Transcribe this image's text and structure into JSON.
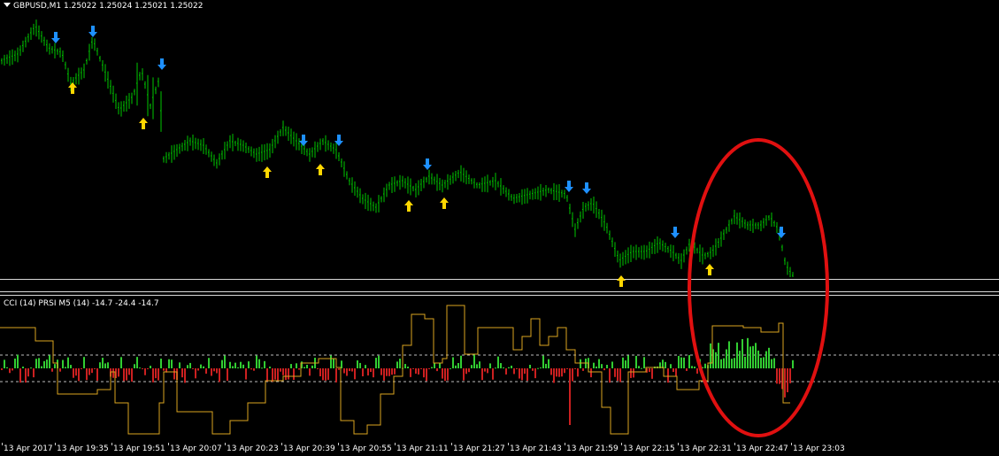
{
  "window": {
    "main_title": "GBPUSD,M1  1.25022 1.25024 1.25021 1.25022",
    "sub_title": "CCI (14) PRSI M5 (14) -14.7 -24.4 -14.7"
  },
  "colors": {
    "background": "#000000",
    "candle": "#00c800",
    "up_arrow": "#ffd700",
    "down_arrow": "#1e90ff",
    "hist_pos": "#32cd32",
    "hist_neg": "#cc2020",
    "prsi_line": "#daa520",
    "highlight": "#e01010"
  },
  "icons": {
    "up_arrow": "arrow-up-icon",
    "down_arrow": "arrow-down-icon",
    "menu": "triangle-down-icon"
  },
  "time_axis": [
    "13 Apr 2017",
    "13 Apr 19:35",
    "13 Apr 19:51",
    "13 Apr 20:07",
    "13 Apr 20:23",
    "13 Apr 20:39",
    "13 Apr 20:55",
    "13 Apr 21:11",
    "13 Apr 21:27",
    "13 Apr 21:43",
    "13 Apr 21:59",
    "13 Apr 22:15",
    "13 Apr 22:31",
    "13 Apr 22:47",
    "13 Apr 23:03"
  ]
}
